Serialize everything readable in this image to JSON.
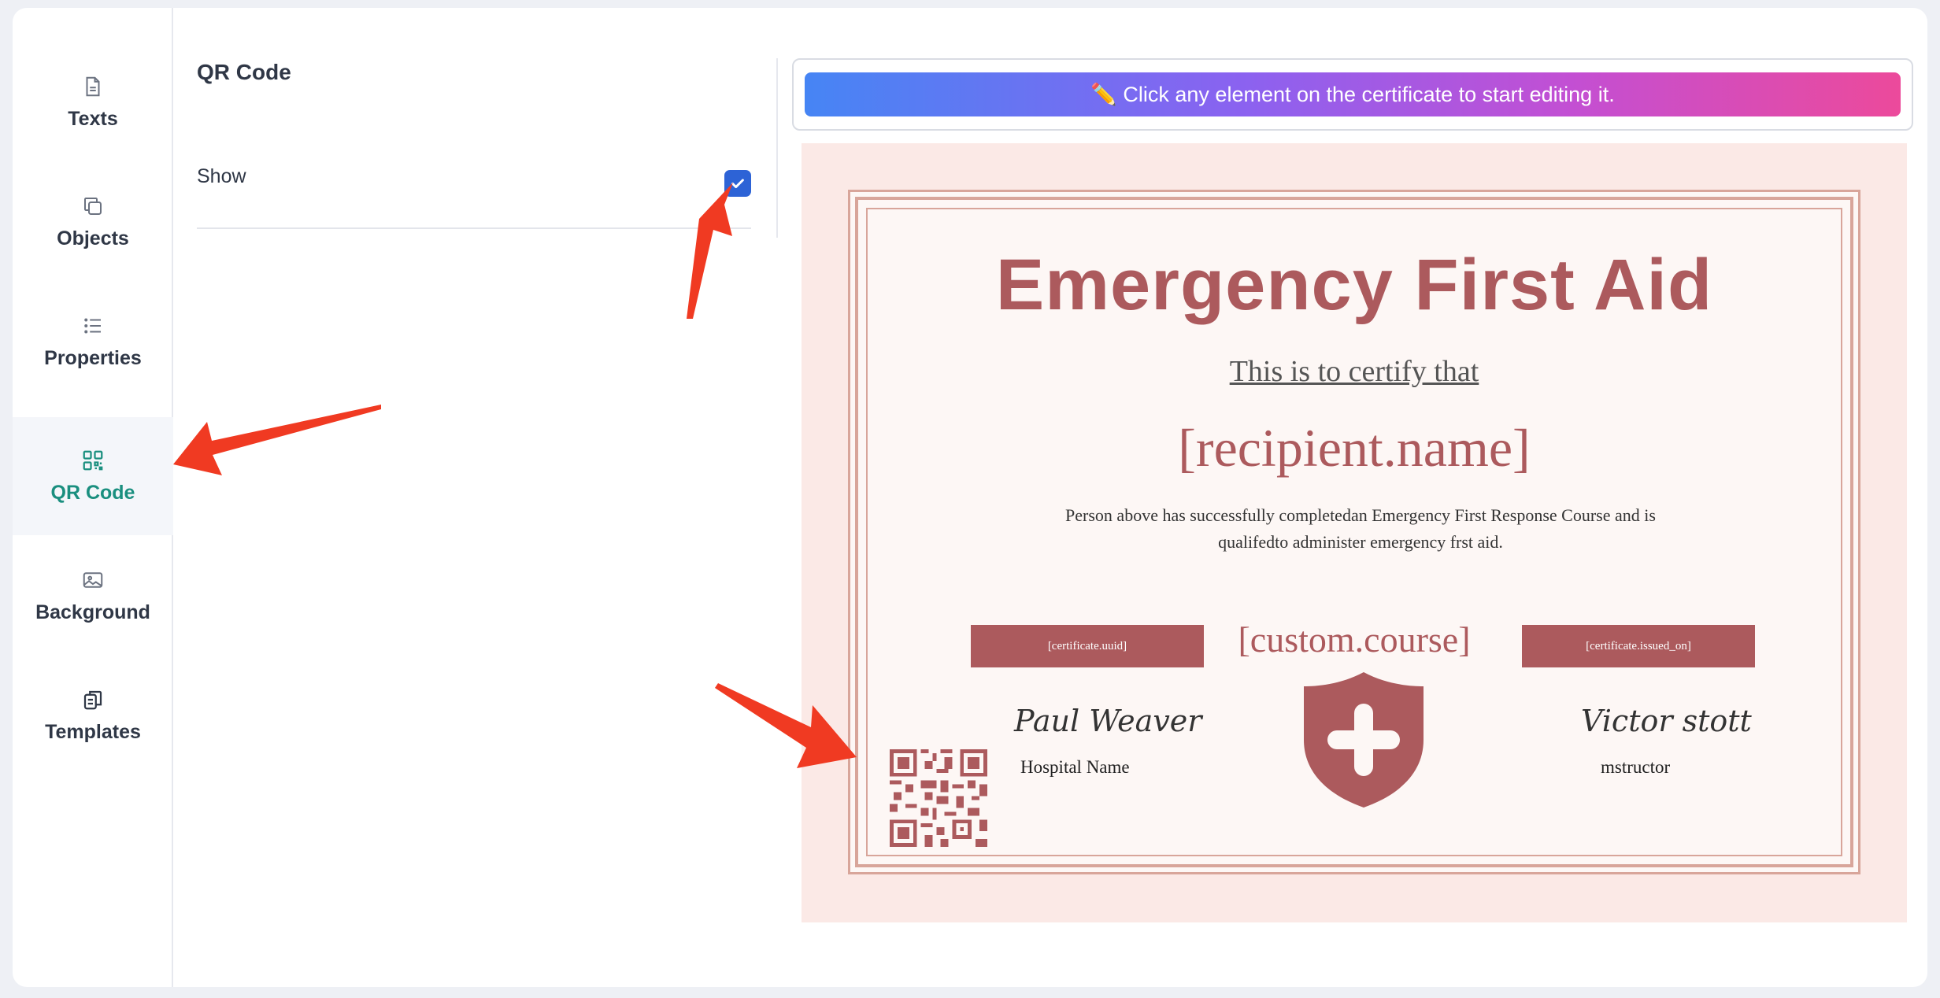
{
  "sidebar": {
    "items": [
      {
        "label": "Texts",
        "icon": "document-icon"
      },
      {
        "label": "Objects",
        "icon": "copy-icon"
      },
      {
        "label": "Properties",
        "icon": "list-icon"
      },
      {
        "label": "QR Code",
        "icon": "qr-code-icon",
        "active": true
      },
      {
        "label": "Background",
        "icon": "image-icon"
      },
      {
        "label": "Templates",
        "icon": "templates-icon"
      }
    ]
  },
  "panel": {
    "title": "QR Code",
    "show_label": "Show",
    "show_checked": true
  },
  "preview": {
    "banner_text": "✏️ Click any element on the certificate to start editing it."
  },
  "certificate": {
    "title": "Emergency First Aid",
    "subtitle": "This is to certify that",
    "recipient": "[recipient.name]",
    "body_line1": "Person above has successfully completedan Emergency First Response Course and is",
    "body_line2": "qualifedto administer emergency frst aid.",
    "uuid_tag": "[certificate.uuid]",
    "course": "[custom.course]",
    "issued_tag": "[certificate.issued_on]",
    "left_signature": "Paul Weaver",
    "left_role": "Hospital Name",
    "right_signature": "Victor stott",
    "right_role": "mstructor"
  },
  "colors": {
    "accent": "#1a8f7f",
    "checkbox": "#2d63d6",
    "certificate_brand": "#ac5a5d",
    "annotation_arrow": "#f03a22"
  }
}
